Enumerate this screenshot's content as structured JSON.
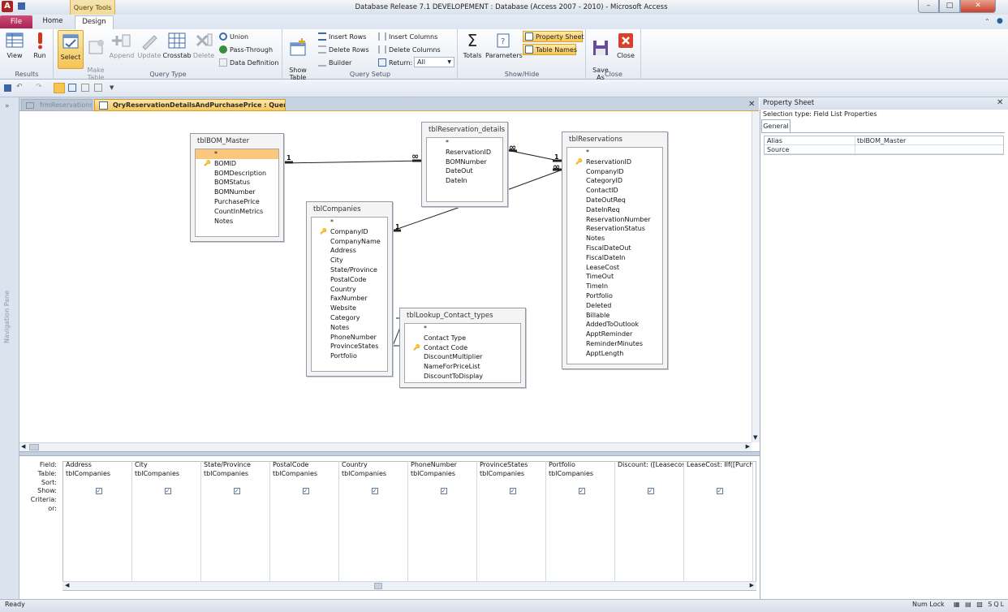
{
  "window": {
    "title": "Database Release 7.1 DEVELOPEMENT : Database (Access 2007 - 2010)  -  Microsoft Access",
    "app_icon": "A",
    "context_tab": "Query Tools",
    "minimize": "–",
    "maximize": "□",
    "close": "✕"
  },
  "tabs": {
    "file": "File",
    "home": "Home",
    "design": "Design"
  },
  "ribbon": {
    "results": {
      "label": "Results",
      "view": "View",
      "run": "Run"
    },
    "query_type": {
      "label": "Query Type",
      "select": "Select",
      "make_table": "Make\nTable",
      "append": "Append",
      "update": "Update",
      "crosstab": "Crosstab",
      "delete": "Delete",
      "union": "Union",
      "pass_through": "Pass-Through",
      "data_definition": "Data Definition"
    },
    "query_setup": {
      "label": "Query Setup",
      "show_table": "Show\nTable",
      "insert_rows": "Insert Rows",
      "delete_rows": "Delete Rows",
      "builder": "Builder",
      "insert_columns": "Insert Columns",
      "delete_columns": "Delete Columns",
      "return_label": "Return:",
      "return_value": "All"
    },
    "show_hide": {
      "label": "Show/Hide",
      "totals": "Totals",
      "parameters": "Parameters",
      "property_sheet": "Property Sheet",
      "table_names": "Table Names"
    },
    "close": {
      "label": "Close",
      "save_as": "Save\nAs",
      "close": "Close"
    }
  },
  "doc_tabs": {
    "tab1": "frmReservations",
    "tab2": "QryReservationDetailsAndPurchasePrice : Query Builder"
  },
  "nav_pane": {
    "label": "Navigation Pane",
    "toggle": "»"
  },
  "tables": {
    "bom": {
      "title": "tblBOM_Master",
      "fields": [
        "*",
        "BOMID",
        "BOMDescription",
        "BOMStatus",
        "BOMNumber",
        "PurchasePrice",
        "CountInMetrics",
        "Notes"
      ]
    },
    "resdetails": {
      "title": "tblReservation_details",
      "fields": [
        "*",
        "ReservationID",
        "BOMNumber",
        "DateOut",
        "DateIn"
      ]
    },
    "reservations": {
      "title": "tblReservations",
      "fields": [
        "*",
        "ReservationID",
        "CompanyID",
        "CategoryID",
        "ContactID",
        "DateOutReq",
        "DateInReq",
        "ReservationNumber",
        "ReservationStatus",
        "Notes",
        "FiscalDateOut",
        "FiscalDateIn",
        "LeaseCost",
        "TimeOut",
        "TimeIn",
        "Portfolio",
        "Deleted",
        "Billable",
        "AddedToOutlook",
        "ApptReminder",
        "ReminderMinutes",
        "ApptLength"
      ]
    },
    "companies": {
      "title": "tblCompanies",
      "fields": [
        "*",
        "CompanyID",
        "CompanyName",
        "Address",
        "City",
        "State/Province",
        "PostalCode",
        "Country",
        "FaxNumber",
        "Website",
        "Category",
        "Notes",
        "PhoneNumber",
        "ProvinceStates",
        "Portfolio"
      ]
    },
    "lookup": {
      "title": "tblLookup_Contact_types",
      "fields": [
        "*",
        "Contact Type",
        "Contact Code",
        "DiscountMultiplier",
        "NameForPriceList",
        "DiscountToDisplay"
      ]
    }
  },
  "relations": {
    "one": "1",
    "many": "∞"
  },
  "grid": {
    "row_labels": [
      "Field:",
      "Table:",
      "Sort:",
      "Show:",
      "Criteria:",
      "or:"
    ],
    "columns": [
      {
        "field": "Address",
        "table": "tblCompanies",
        "show": true
      },
      {
        "field": "City",
        "table": "tblCompanies",
        "show": true
      },
      {
        "field": "State/Province",
        "table": "tblCompanies",
        "show": true
      },
      {
        "field": "PostalCode",
        "table": "tblCompanies",
        "show": true
      },
      {
        "field": "Country",
        "table": "tblCompanies",
        "show": true
      },
      {
        "field": "PhoneNumber",
        "table": "tblCompanies",
        "show": true
      },
      {
        "field": "ProvinceStates",
        "table": "tblCompanies",
        "show": true
      },
      {
        "field": "Portfolio",
        "table": "tblCompanies",
        "show": true
      },
      {
        "field": "Discount: ([Leasecost]",
        "table": "",
        "show": true
      },
      {
        "field": "LeaseCost: IIf([Purcha:",
        "table": "",
        "show": true
      }
    ]
  },
  "property_sheet": {
    "title": "Property Sheet",
    "selection_type": "Selection type:  Field List Properties",
    "tab": "General",
    "rows": [
      {
        "key": "Alias",
        "value": "tblBOM_Master"
      },
      {
        "key": "Source",
        "value": ""
      }
    ]
  },
  "status": {
    "ready": "Ready",
    "num_lock": "Num Lock",
    "view_icons": "▦ ▤ ▧ SQL"
  }
}
